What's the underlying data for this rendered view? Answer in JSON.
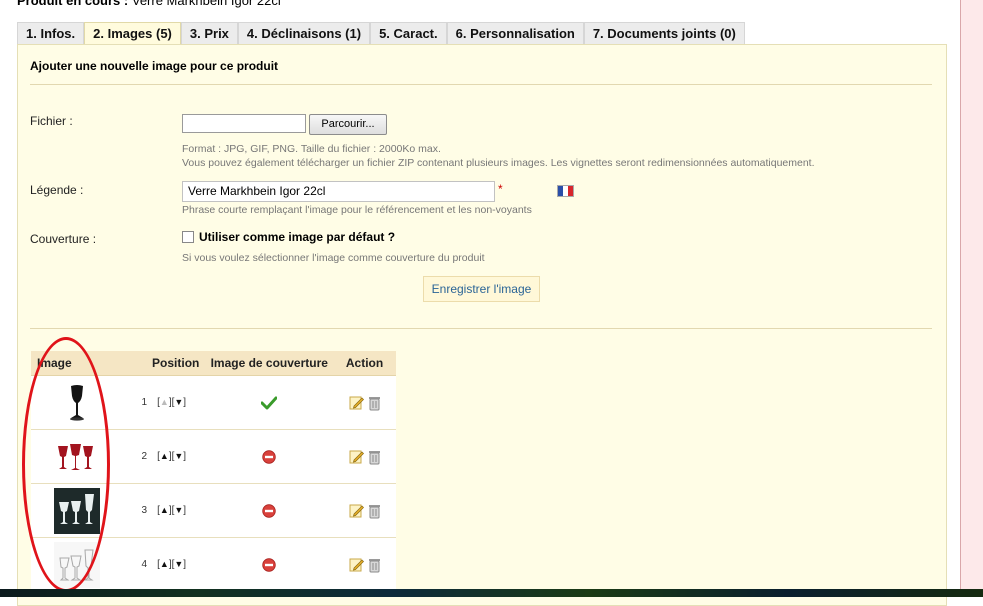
{
  "current_product": {
    "label": "Produit en cours :",
    "name": "Verre Markhbein Igor 22cl"
  },
  "tabs": [
    {
      "label": "1. Infos.",
      "active": false
    },
    {
      "label": "2. Images (5)",
      "active": true
    },
    {
      "label": "3. Prix",
      "active": false
    },
    {
      "label": "4. Déclinaisons (1)",
      "active": false
    },
    {
      "label": "5. Caract.",
      "active": false
    },
    {
      "label": "6. Personnalisation",
      "active": false
    },
    {
      "label": "7. Documents joints (0)",
      "active": false
    }
  ],
  "form": {
    "section_title": "Ajouter une nouvelle image pour ce produit",
    "file_label": "Fichier :",
    "browse_label": "Parcourir...",
    "file_hint_1": "Format : JPG, GIF, PNG. Taille du fichier : 2000Ko max.",
    "file_hint_2": "Vous pouvez également télécharger un fichier ZIP contenant plusieurs images. Les vignettes seront redimensionnées automatiquement.",
    "legend_label": "Légende :",
    "legend_value": "Verre Markhbein Igor 22cl",
    "required_mark": "*",
    "legend_hint": "Phrase courte remplaçant l'image pour le référencement et les non-voyants",
    "cover_label": "Couverture :",
    "cover_checkbox_label": "Utiliser comme image par défaut ?",
    "cover_hint": "Si vous voulez sélectionner l'image comme couverture du produit",
    "save_label": "Enregistrer l'image"
  },
  "table": {
    "headers": {
      "image": "Image",
      "position": "Position",
      "cover": "Image de couverture",
      "action": "Action"
    },
    "rows": [
      {
        "position": "1",
        "is_cover": true,
        "thumb": "black-glass"
      },
      {
        "position": "2",
        "is_cover": false,
        "thumb": "red-glasses"
      },
      {
        "position": "3",
        "is_cover": false,
        "thumb": "clear-glasses-dark"
      },
      {
        "position": "4",
        "is_cover": false,
        "thumb": "clear-glasses-light"
      }
    ],
    "arrows": {
      "up": "▲",
      "down": "▼",
      "open": "[",
      "close": "]"
    }
  },
  "colors": {
    "panel_bg": "#fffde6",
    "header_bg": "#f5e6c4",
    "annotation_red": "#e0141a",
    "cover_check": "#3a9b2b",
    "not_cover": "#d9413c"
  },
  "icons": {
    "flag": "flag-fr-icon",
    "cover_yes": "check-icon",
    "cover_no": "no-entry-icon",
    "edit": "pencil-icon",
    "delete": "trash-icon"
  }
}
